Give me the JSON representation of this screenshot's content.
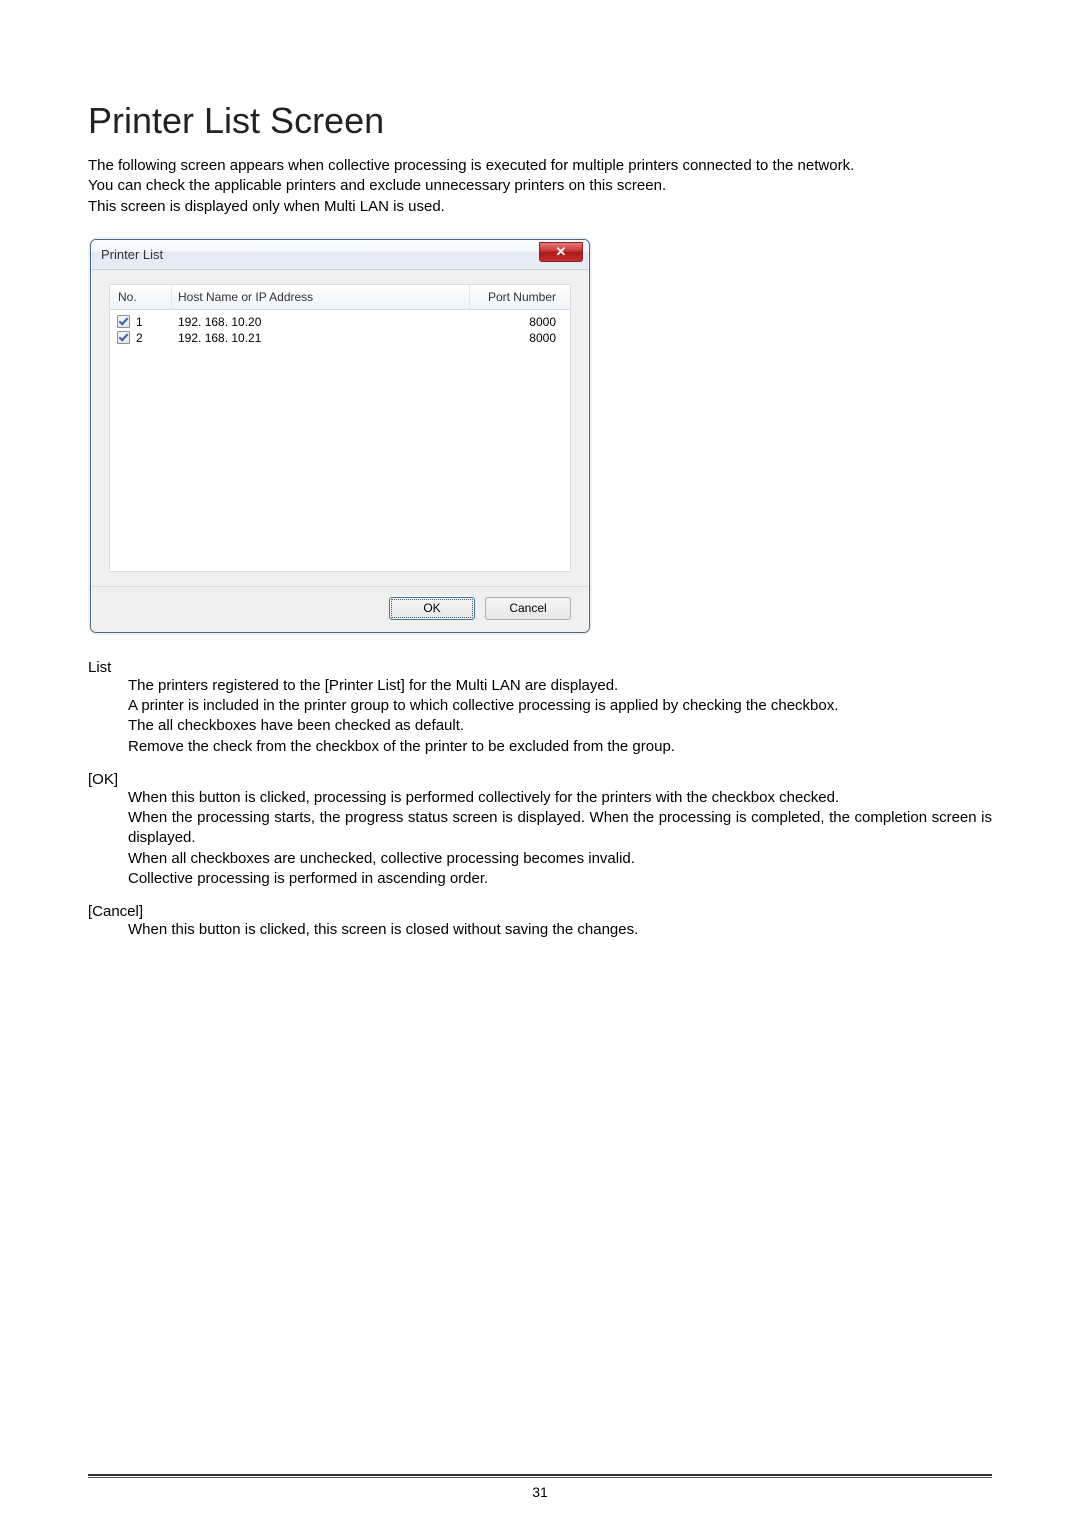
{
  "page": {
    "number": "31"
  },
  "heading": "Printer List Screen",
  "intro": {
    "p1": "The following screen appears when collective processing is executed for multiple printers connected to the network.",
    "p2": "You can check the applicable printers and exclude unnecessary printers on this screen.",
    "p3": "This screen is displayed only when Multi LAN is used."
  },
  "dialog": {
    "title": "Printer List",
    "close_glyph": "✕",
    "headers": {
      "no": "No.",
      "host": "Host Name or IP Address",
      "port": "Port Number"
    },
    "rows": [
      {
        "checked": true,
        "no": "1",
        "host": "192. 168. 10.20",
        "port": "8000"
      },
      {
        "checked": true,
        "no": "2",
        "host": "192. 168. 10.21",
        "port": "8000"
      }
    ],
    "buttons": {
      "ok": "OK",
      "cancel": "Cancel"
    }
  },
  "descriptions": {
    "list": {
      "term": "List",
      "p1": "The printers registered to the [Printer List] for the Multi LAN are displayed.",
      "p2": "A printer is included in the printer group to which collective processing is applied by checking the checkbox.",
      "p3": "The all checkboxes have been checked as default.",
      "p4": "Remove the check from the checkbox of the printer to be excluded from the group."
    },
    "ok": {
      "term": "[OK]",
      "p1": "When this button is clicked, processing is performed collectively for the printers with the checkbox checked.",
      "p2": "When the processing starts, the progress status screen is displayed.   When the processing is completed, the completion screen is displayed.",
      "p3": "When all checkboxes are unchecked, collective processing becomes invalid.",
      "p4": "Collective processing is performed in ascending order."
    },
    "cancel": {
      "term": "[Cancel]",
      "p1": "When this button is clicked, this screen is closed without saving the changes."
    }
  }
}
